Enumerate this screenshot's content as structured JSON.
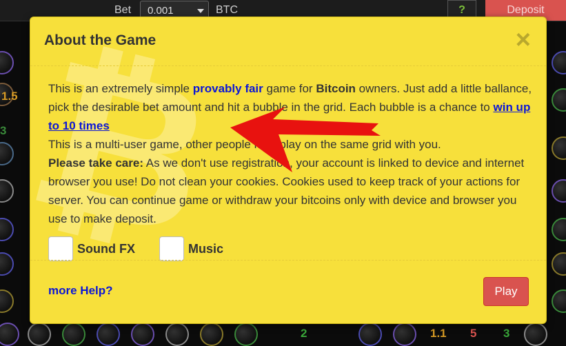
{
  "topbar": {
    "bet_label": "Bet",
    "bet_value": "0.001",
    "currency": "BTC",
    "help_label": "?",
    "deposit_label": "Deposit"
  },
  "grid": {
    "left_numbers": [
      "1.5",
      "3"
    ],
    "bottom_numbers": [
      "2",
      "1.1",
      "5",
      "3"
    ]
  },
  "modal": {
    "title": "About the Game",
    "close_label": "×",
    "para1_pre": "This is an extremely simple ",
    "provably_fair": "provably fair",
    "para1_mid": " game for ",
    "bitcoin": "Bitcoin",
    "para1_post": " owners. Just add a little ballance, pick the desirable bet amount and hit a bubble in the grid. Each bubble is a chance to ",
    "win_link": "win up to 10 times",
    "para2": "This is a multi-user game, other people may play on the same grid with you.",
    "take_care": "Please take care:",
    "para3": " As we don't use registration, your account is linked to device and internet browser you use! Do not clean your cookies. Cookies used to keep track of your actions for server. You can continue game or withdraw your bitcoins only with device and browser you use to make deposit.",
    "sound_label": "Sound FX",
    "music_label": "Music",
    "more_help": "more Help?",
    "play_label": "Play"
  },
  "colors": {
    "modal_bg": "#f7e03b",
    "link": "#0b16d6",
    "play_button": "#d9534f",
    "arrow": "#e8120f"
  }
}
